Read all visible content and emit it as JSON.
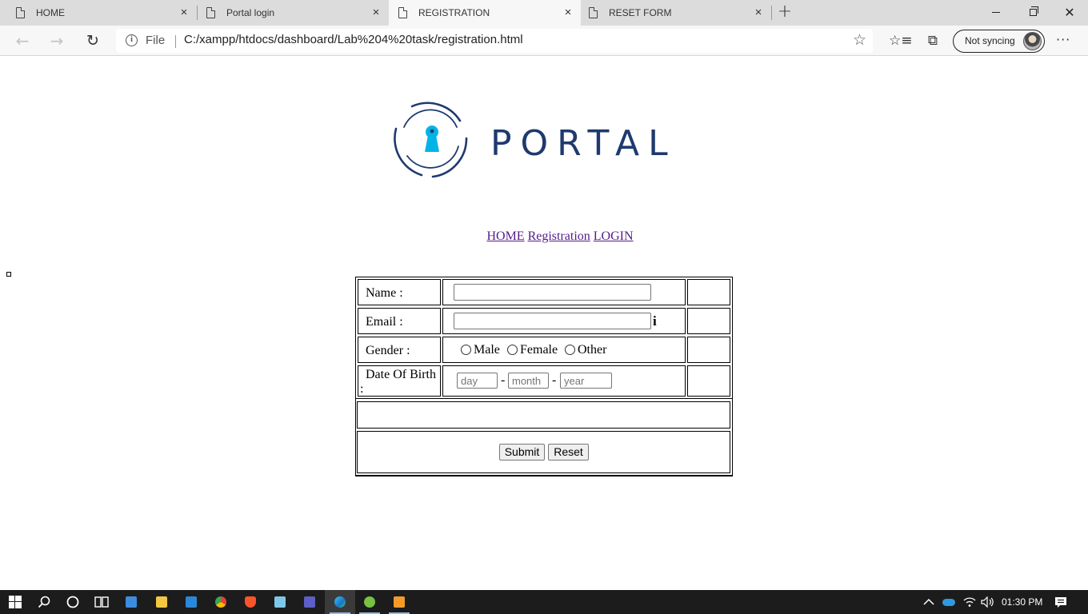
{
  "browser": {
    "tabs": [
      {
        "title": "HOME",
        "close": "×"
      },
      {
        "title": "Portal login",
        "close": "×"
      },
      {
        "title": "REGISTRATION",
        "close": "×"
      },
      {
        "title": "RESET FORM",
        "close": "×"
      }
    ],
    "new_tab": "+",
    "window_close": "✕",
    "address": {
      "scheme_label": "File",
      "url": "C:/xampp/htdocs/dashboard/Lab%204%20task/registration.html"
    },
    "sync_label": "Not syncing",
    "more": "···",
    "icons": {
      "info": "i",
      "star": "☆",
      "favorites": "☆≡",
      "collections": "⧉",
      "back": "←",
      "forward": "→",
      "refresh": "↻"
    }
  },
  "page": {
    "logo_text": "PORTAL",
    "colors": {
      "logo_dark": "#1e3a6e",
      "logo_accent": "#00b4e6",
      "visited_link": "#551a8b"
    },
    "nav": [
      {
        "label": "HOME"
      },
      {
        "label": "Registration"
      },
      {
        "label": "LOGIN"
      }
    ],
    "form": {
      "name_label": "Name :",
      "name_value": "",
      "email_label": "Email :",
      "email_value": "",
      "email_info": "i",
      "gender_label": "Gender :",
      "gender_options": [
        "Male",
        "Female",
        "Other"
      ],
      "dob_label_line1": "Date Of Birth",
      "dob_label_line2": ":",
      "dob_placeholders": {
        "day": "day",
        "month": "month",
        "year": "year"
      },
      "dob_separator": "-",
      "submit_label": "Submit",
      "reset_label": "Reset"
    }
  },
  "taskbar": {
    "clock": "01:30 PM",
    "apps": [
      "start",
      "search",
      "cortana",
      "task-view",
      "control-panel",
      "file-explorer",
      "mail",
      "chrome",
      "brave",
      "notepad",
      "teams",
      "edge",
      "utorrent",
      "sublime-text"
    ]
  }
}
